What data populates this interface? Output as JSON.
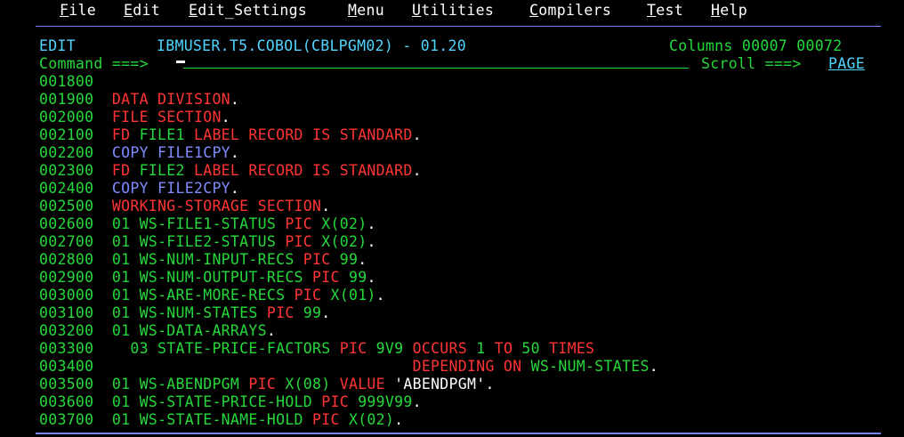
{
  "menu": {
    "items": [
      {
        "hot": "F",
        "rest": "ile"
      },
      {
        "hot": "E",
        "rest": "dit"
      },
      {
        "hot": "E",
        "rest": "dit_Settings"
      },
      {
        "hot": "M",
        "rest": "enu"
      },
      {
        "hot": "U",
        "rest": "tilities"
      },
      {
        "hot": "C",
        "rest": "ompilers"
      },
      {
        "hot": "T",
        "rest": "est"
      },
      {
        "hot": "H",
        "rest": "elp"
      }
    ]
  },
  "header": {
    "mode": "EDIT",
    "dataset": "IBMUSER.T5.COBOL(CBLPGM02) - 01.20",
    "columns_label": "Columns",
    "col_start": "00007",
    "col_end": "00072",
    "command_label": "Command ===>",
    "command_value": "",
    "scroll_label": "Scroll ===>",
    "scroll_value": "PAGE"
  },
  "source_lines": [
    {
      "num": "001800",
      "tokens": []
    },
    {
      "num": "001900",
      "tokens": [
        {
          "t": "DATA DIVISION",
          "c": "r"
        },
        {
          "t": ".",
          "c": "w"
        }
      ]
    },
    {
      "num": "002000",
      "tokens": [
        {
          "t": "FILE SECTION",
          "c": "r"
        },
        {
          "t": ".",
          "c": "w"
        }
      ]
    },
    {
      "num": "002100",
      "tokens": [
        {
          "t": "FD ",
          "c": "r"
        },
        {
          "t": "FILE1 ",
          "c": "g"
        },
        {
          "t": "LABEL RECORD IS STANDARD",
          "c": "r"
        },
        {
          "t": ".",
          "c": "w"
        }
      ]
    },
    {
      "num": "002200",
      "tokens": [
        {
          "t": "COPY FILE1CPY",
          "c": "b"
        },
        {
          "t": ".",
          "c": "w"
        }
      ]
    },
    {
      "num": "002300",
      "tokens": [
        {
          "t": "FD ",
          "c": "r"
        },
        {
          "t": "FILE2 ",
          "c": "g"
        },
        {
          "t": "LABEL RECORD IS STANDARD",
          "c": "r"
        },
        {
          "t": ".",
          "c": "w"
        }
      ]
    },
    {
      "num": "002400",
      "tokens": [
        {
          "t": "COPY FILE2CPY",
          "c": "b"
        },
        {
          "t": ".",
          "c": "w"
        }
      ]
    },
    {
      "num": "002500",
      "tokens": [
        {
          "t": "WORKING-STORAGE SECTION",
          "c": "r"
        },
        {
          "t": ".",
          "c": "w"
        }
      ]
    },
    {
      "num": "002600",
      "tokens": [
        {
          "t": "01 WS-FILE1-STATUS ",
          "c": "g"
        },
        {
          "t": "PIC ",
          "c": "r"
        },
        {
          "t": "X(02)",
          "c": "g"
        },
        {
          "t": ".",
          "c": "w"
        }
      ]
    },
    {
      "num": "002700",
      "tokens": [
        {
          "t": "01 WS-FILE2-STATUS ",
          "c": "g"
        },
        {
          "t": "PIC ",
          "c": "r"
        },
        {
          "t": "X(02)",
          "c": "g"
        },
        {
          "t": ".",
          "c": "w"
        }
      ]
    },
    {
      "num": "002800",
      "tokens": [
        {
          "t": "01 WS-NUM-INPUT-RECS ",
          "c": "g"
        },
        {
          "t": "PIC ",
          "c": "r"
        },
        {
          "t": "99",
          "c": "g"
        },
        {
          "t": ".",
          "c": "w"
        }
      ]
    },
    {
      "num": "002900",
      "tokens": [
        {
          "t": "01 WS-NUM-OUTPUT-RECS ",
          "c": "g"
        },
        {
          "t": "PIC ",
          "c": "r"
        },
        {
          "t": "99",
          "c": "g"
        },
        {
          "t": ".",
          "c": "w"
        }
      ]
    },
    {
      "num": "003000",
      "tokens": [
        {
          "t": "01 WS-ARE-MORE-RECS ",
          "c": "g"
        },
        {
          "t": "PIC ",
          "c": "r"
        },
        {
          "t": "X(01)",
          "c": "g"
        },
        {
          "t": ".",
          "c": "w"
        }
      ]
    },
    {
      "num": "003100",
      "tokens": [
        {
          "t": "01 WS-NUM-STATES ",
          "c": "g"
        },
        {
          "t": "PIC ",
          "c": "r"
        },
        {
          "t": "99",
          "c": "g"
        },
        {
          "t": ".",
          "c": "w"
        }
      ]
    },
    {
      "num": "003200",
      "tokens": [
        {
          "t": "01 WS-DATA-ARRAYS",
          "c": "g"
        },
        {
          "t": ".",
          "c": "w"
        }
      ]
    },
    {
      "num": "003300",
      "tokens": [
        {
          "t": "  03 STATE-PRICE-FACTORS ",
          "c": "g"
        },
        {
          "t": "PIC ",
          "c": "r"
        },
        {
          "t": "9V9 ",
          "c": "g"
        },
        {
          "t": "OCCURS ",
          "c": "r"
        },
        {
          "t": "1 ",
          "c": "g"
        },
        {
          "t": "TO ",
          "c": "r"
        },
        {
          "t": "50 ",
          "c": "g"
        },
        {
          "t": "TIMES",
          "c": "r"
        }
      ]
    },
    {
      "num": "003400",
      "tokens": [
        {
          "t": "                                 ",
          "c": "g"
        },
        {
          "t": "DEPENDING ON ",
          "c": "r"
        },
        {
          "t": "WS-NUM-STATES",
          "c": "g"
        },
        {
          "t": ".",
          "c": "w"
        }
      ]
    },
    {
      "num": "003500",
      "tokens": [
        {
          "t": "01 WS-ABENDPGM ",
          "c": "g"
        },
        {
          "t": "PIC ",
          "c": "r"
        },
        {
          "t": "X(08) ",
          "c": "g"
        },
        {
          "t": "VALUE ",
          "c": "r"
        },
        {
          "t": "'ABENDPGM'",
          "c": "w"
        },
        {
          "t": ".",
          "c": "w"
        }
      ]
    },
    {
      "num": "003600",
      "tokens": [
        {
          "t": "01 WS-STATE-PRICE-HOLD ",
          "c": "g"
        },
        {
          "t": "PIC ",
          "c": "r"
        },
        {
          "t": "999V99",
          "c": "g"
        },
        {
          "t": ".",
          "c": "w"
        }
      ]
    },
    {
      "num": "003700",
      "tokens": [
        {
          "t": "01 WS-STATE-NAME-HOLD ",
          "c": "g"
        },
        {
          "t": "PIC ",
          "c": "r"
        },
        {
          "t": "X(02)",
          "c": "g"
        },
        {
          "t": ".",
          "c": "w"
        }
      ]
    }
  ]
}
